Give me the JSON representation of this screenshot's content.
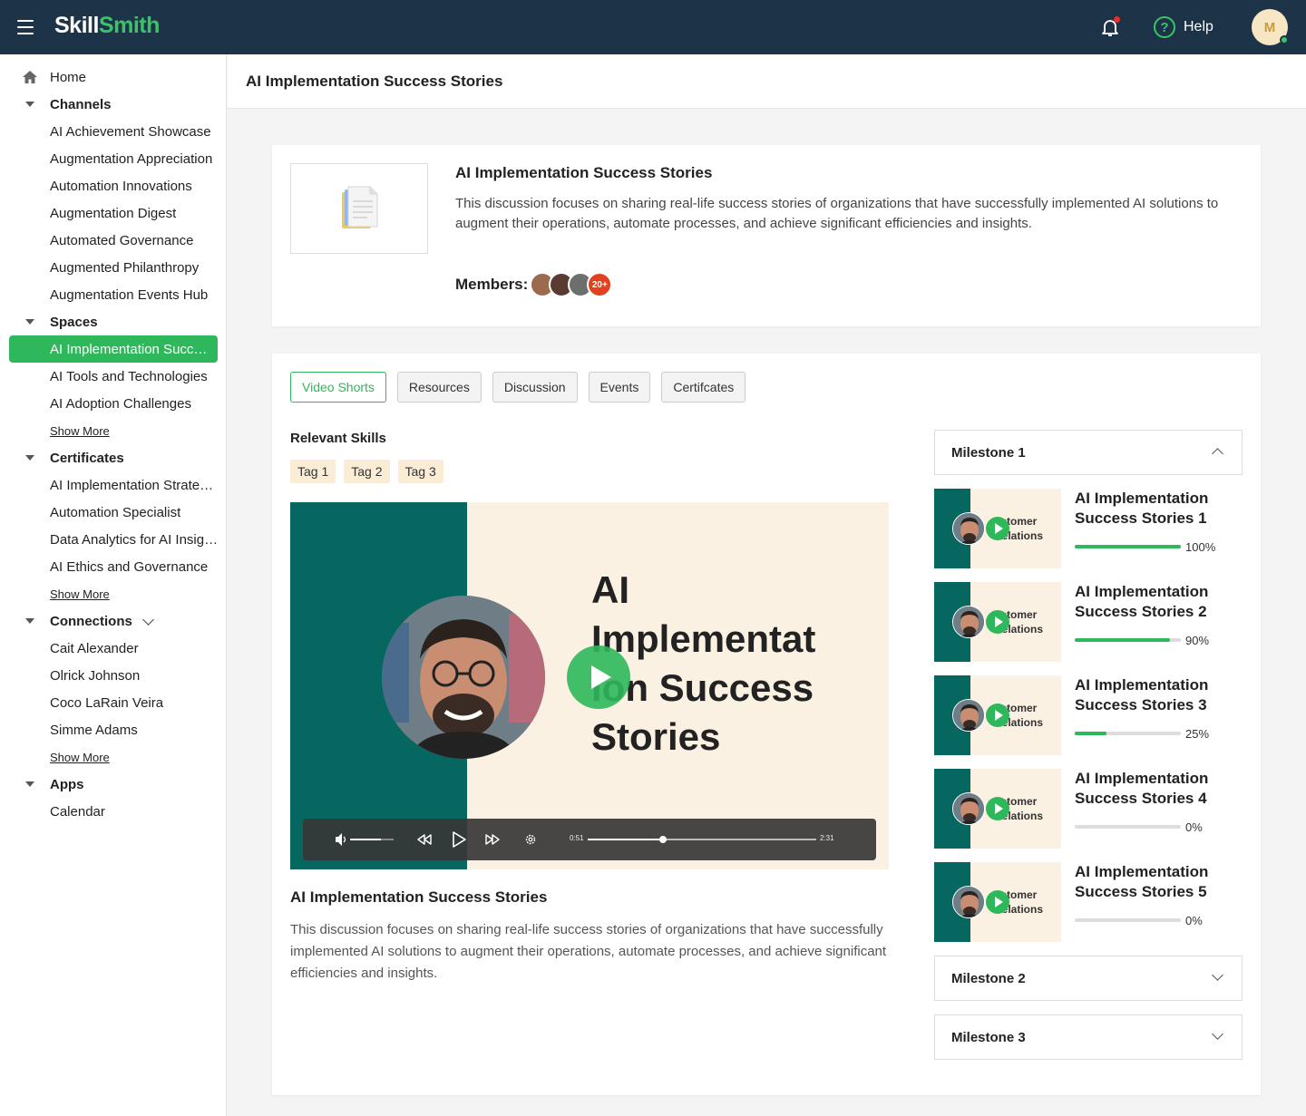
{
  "topbar": {
    "logo_part1": "Skill",
    "logo_part2": "Smith",
    "help_label": "Help",
    "help_icon": "?",
    "avatar_initial": "M"
  },
  "sidebar": {
    "home": "Home",
    "channels": {
      "label": "Channels",
      "items": [
        "AI Achievement Showcase",
        "Augmentation Appreciation",
        "Automation Innovations",
        "Augmentation Digest",
        "Automated Governance",
        "Augmented Philanthropy",
        "Augmentation Events Hub"
      ]
    },
    "spaces": {
      "label": "Spaces",
      "items": [
        "AI Implementation Success Stories",
        "AI Tools and Technologies",
        "AI Adoption Challenges"
      ],
      "show_more": "Show More"
    },
    "certificates": {
      "label": "Certificates",
      "items": [
        "AI Implementation Strategist",
        "Automation Specialist",
        "Data Analytics for AI Insights",
        "AI Ethics and Governance"
      ],
      "show_more": "Show More"
    },
    "connections": {
      "label": "Connections",
      "items": [
        "Cait Alexander",
        "Olrick Johnson",
        "Coco LaRain Veira",
        "Simme Adams"
      ],
      "show_more": "Show More"
    },
    "apps": {
      "label": "Apps",
      "items": [
        "Calendar"
      ]
    }
  },
  "page": {
    "title": "AI Implementation Success Stories"
  },
  "overview": {
    "title": "AI Implementation Success Stories",
    "description": "This discussion focuses on sharing real-life success stories of organizations that have successfully implemented AI solutions to augment their operations, automate processes, and achieve significant efficiencies and insights.",
    "members_label": "Members:",
    "members_more": "20+"
  },
  "tabs": [
    "Video Shorts",
    "Resources",
    "Discussion",
    "Events",
    "Certifcates"
  ],
  "skills": {
    "heading": "Relevant Skills",
    "tags": [
      "Tag 1",
      "Tag 2",
      "Tag 3"
    ]
  },
  "video": {
    "title_line1": "AI",
    "title_line2": "Implementat",
    "title_line3": "ion Success",
    "title_line4": "Stories",
    "current_time": "0:51",
    "duration": "2:31",
    "progress": 0.33,
    "volume": 0.7
  },
  "video_caption": {
    "title": "AI Implementation Success Stories",
    "description": "This discussion focuses on sharing real-life success stories of organizations that have successfully implemented AI solutions to augment their operations, automate processes, and achieve significant efficiencies and insights."
  },
  "milestones": {
    "m1": "Milestone 1",
    "m2": "Milestone 2",
    "m3": "Milestone 3",
    "thumb_line1": "ustomer",
    "thumb_line2": "Relations",
    "items": [
      {
        "title": "AI Implementation Success Stories 1",
        "percent": "100%",
        "progress": 1.0
      },
      {
        "title": "AI Implementation Success Stories 2",
        "percent": "90%",
        "progress": 0.9
      },
      {
        "title": "AI Implementation Success Stories 3",
        "percent": "25%",
        "progress": 0.3
      },
      {
        "title": "AI Implementation Success Stories 4",
        "percent": "0%",
        "progress": 0
      },
      {
        "title": "AI Implementation Success Stories 5",
        "percent": "0%",
        "progress": 0
      }
    ]
  }
}
